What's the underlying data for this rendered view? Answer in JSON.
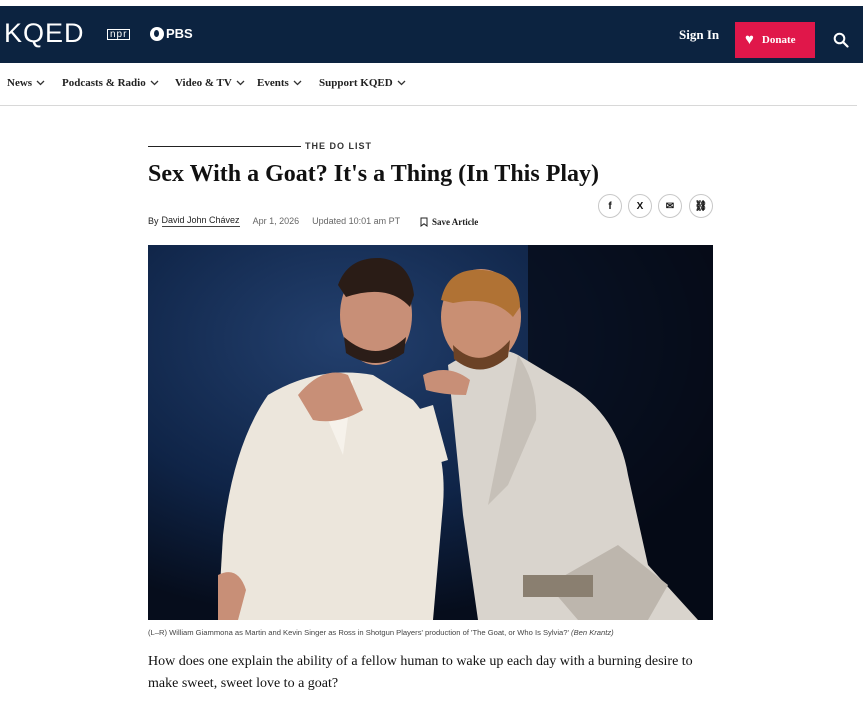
{
  "header": {
    "logo": "KQED",
    "npr": "npr",
    "pbs": "PBS",
    "signin": "Sign In",
    "donate": "Donate"
  },
  "nav": {
    "items": [
      {
        "label": "News"
      },
      {
        "label": "Podcasts & Radio"
      },
      {
        "label": "Video & TV"
      },
      {
        "label": "Events"
      },
      {
        "label": "Support KQED"
      }
    ]
  },
  "article": {
    "kicker": "THE DO LIST",
    "title": "Sex With a Goat? It's a Thing (In This Play)",
    "by": "By",
    "author": "David John Chávez",
    "date": "Apr 1, 2026",
    "updated": "Updated 10:01 am PT",
    "save": "Save Article",
    "share": {
      "facebook": "f",
      "x": "X",
      "email": "✉",
      "link": "⛓"
    },
    "caption": "(L–R) William Giammona as Martin and Kevin Singer as Ross in Shotgun Players' production of 'The Goat, or Who Is Sylvia?'",
    "credit": "(Ben Krantz)",
    "lede": "How does one explain the ability of a fellow human to wake up each day with a burning desire to make sweet, sweet love to a goat?"
  },
  "colors": {
    "header_bg": "#0c2340",
    "donate_bg": "#e0174a"
  }
}
